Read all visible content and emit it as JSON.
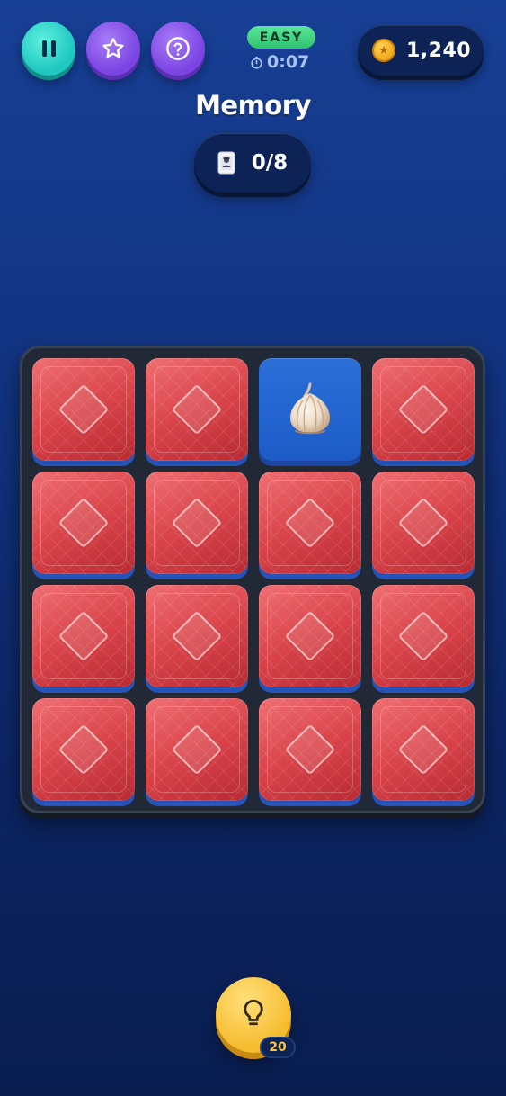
{
  "header": {
    "pause_icon": "pause-icon",
    "star_icon": "star-icon",
    "help_icon": "question-mark-icon",
    "difficulty": "EASY",
    "timer_icon": "stopwatch-icon",
    "timer": "0:07",
    "coin_icon": "coin-icon",
    "coins": "1,240"
  },
  "game": {
    "title": "Memory",
    "pairs_icon": "playing-card-icon",
    "pairs_progress": "0/8"
  },
  "board": {
    "rows": 4,
    "columns": 4,
    "cards": [
      {
        "state": "face-down"
      },
      {
        "state": "face-down"
      },
      {
        "state": "face-up",
        "symbol": "garlic"
      },
      {
        "state": "face-down"
      },
      {
        "state": "face-down"
      },
      {
        "state": "face-down"
      },
      {
        "state": "face-down"
      },
      {
        "state": "face-down"
      },
      {
        "state": "face-down"
      },
      {
        "state": "face-down"
      },
      {
        "state": "face-down"
      },
      {
        "state": "face-down"
      },
      {
        "state": "face-down"
      },
      {
        "state": "face-down"
      },
      {
        "state": "face-down"
      },
      {
        "state": "face-down"
      }
    ]
  },
  "hint": {
    "icon": "lightbulb-icon",
    "count": "20"
  },
  "colors": {
    "card_back": "#d9444a",
    "card_face": "#2b6fd8",
    "difficulty_badge": "#3fd07e",
    "hint_button": "#f6bb2e",
    "pause_button": "#1fc7c0",
    "purple_button": "#7c45e3"
  }
}
